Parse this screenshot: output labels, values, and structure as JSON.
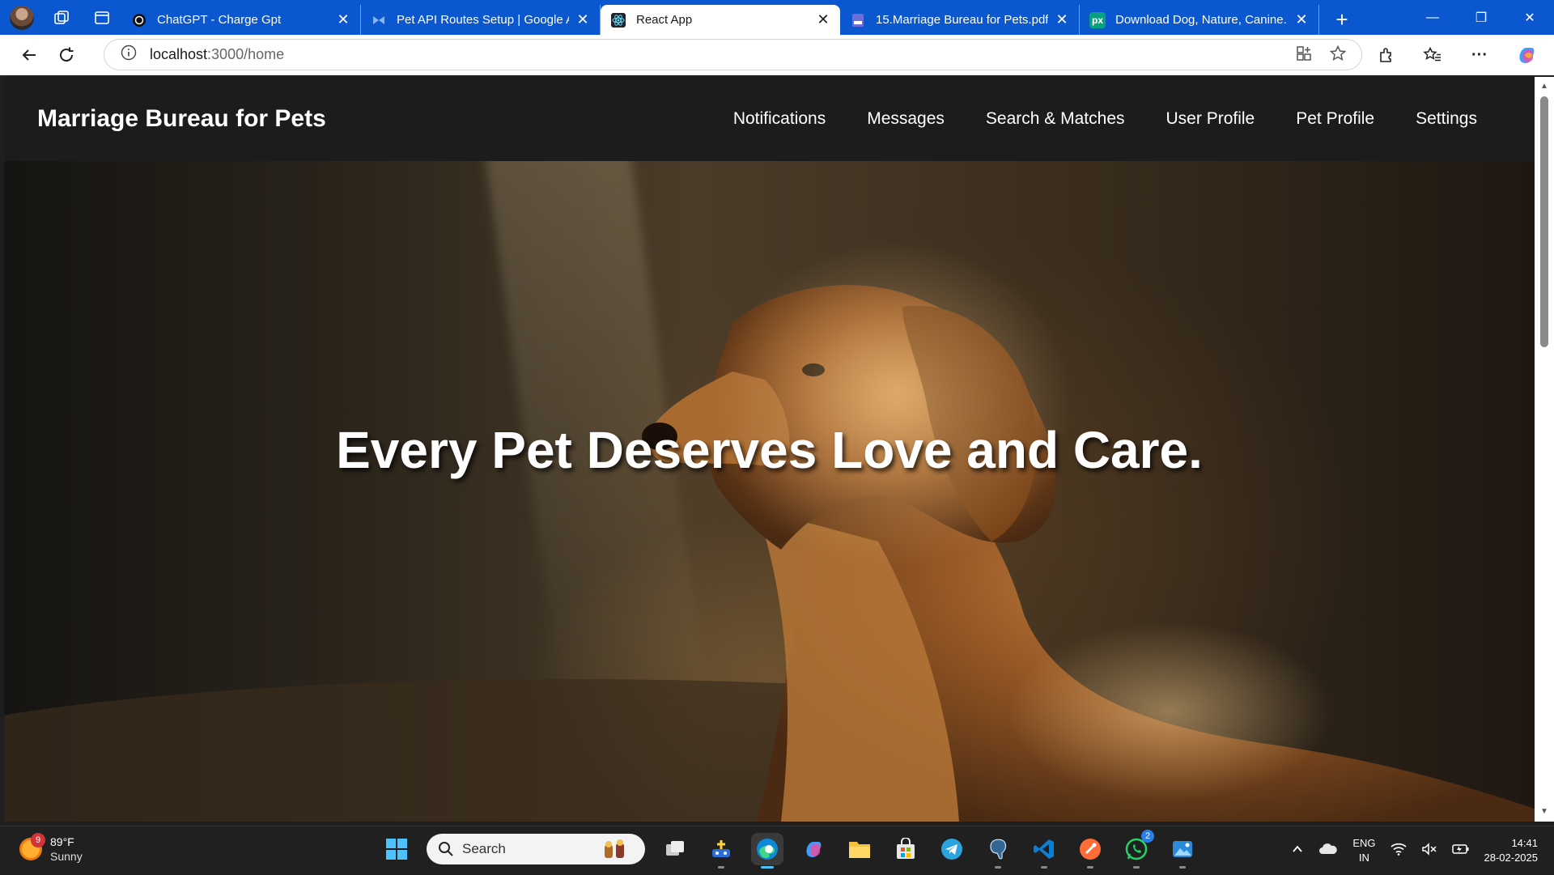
{
  "browser": {
    "tabs": [
      {
        "title": "ChatGPT - Charge Gpt",
        "active": false
      },
      {
        "title": "Pet API Routes Setup | Google AI",
        "active": false
      },
      {
        "title": "React App",
        "active": true
      },
      {
        "title": "15.Marriage Bureau for Pets.pdf",
        "active": false
      },
      {
        "title": "Download Dog, Nature, Canine. Royalty-Free",
        "active": false
      }
    ],
    "url_host": "localhost",
    "url_path": ":3000/home"
  },
  "page": {
    "brand": "Marriage Bureau for Pets",
    "nav": [
      "Notifications",
      "Messages",
      "Search & Matches",
      "User Profile",
      "Pet Profile",
      "Settings"
    ],
    "hero_title": "Every Pet Deserves Love and Care."
  },
  "taskbar": {
    "weather_temp": "89°F",
    "weather_desc": "Sunny",
    "weather_badge": "9",
    "search_placeholder": "Search",
    "whatsapp_badge": "2",
    "lang_line1": "ENG",
    "lang_line2": "IN",
    "time": "14:41",
    "date": "28-02-2025"
  }
}
